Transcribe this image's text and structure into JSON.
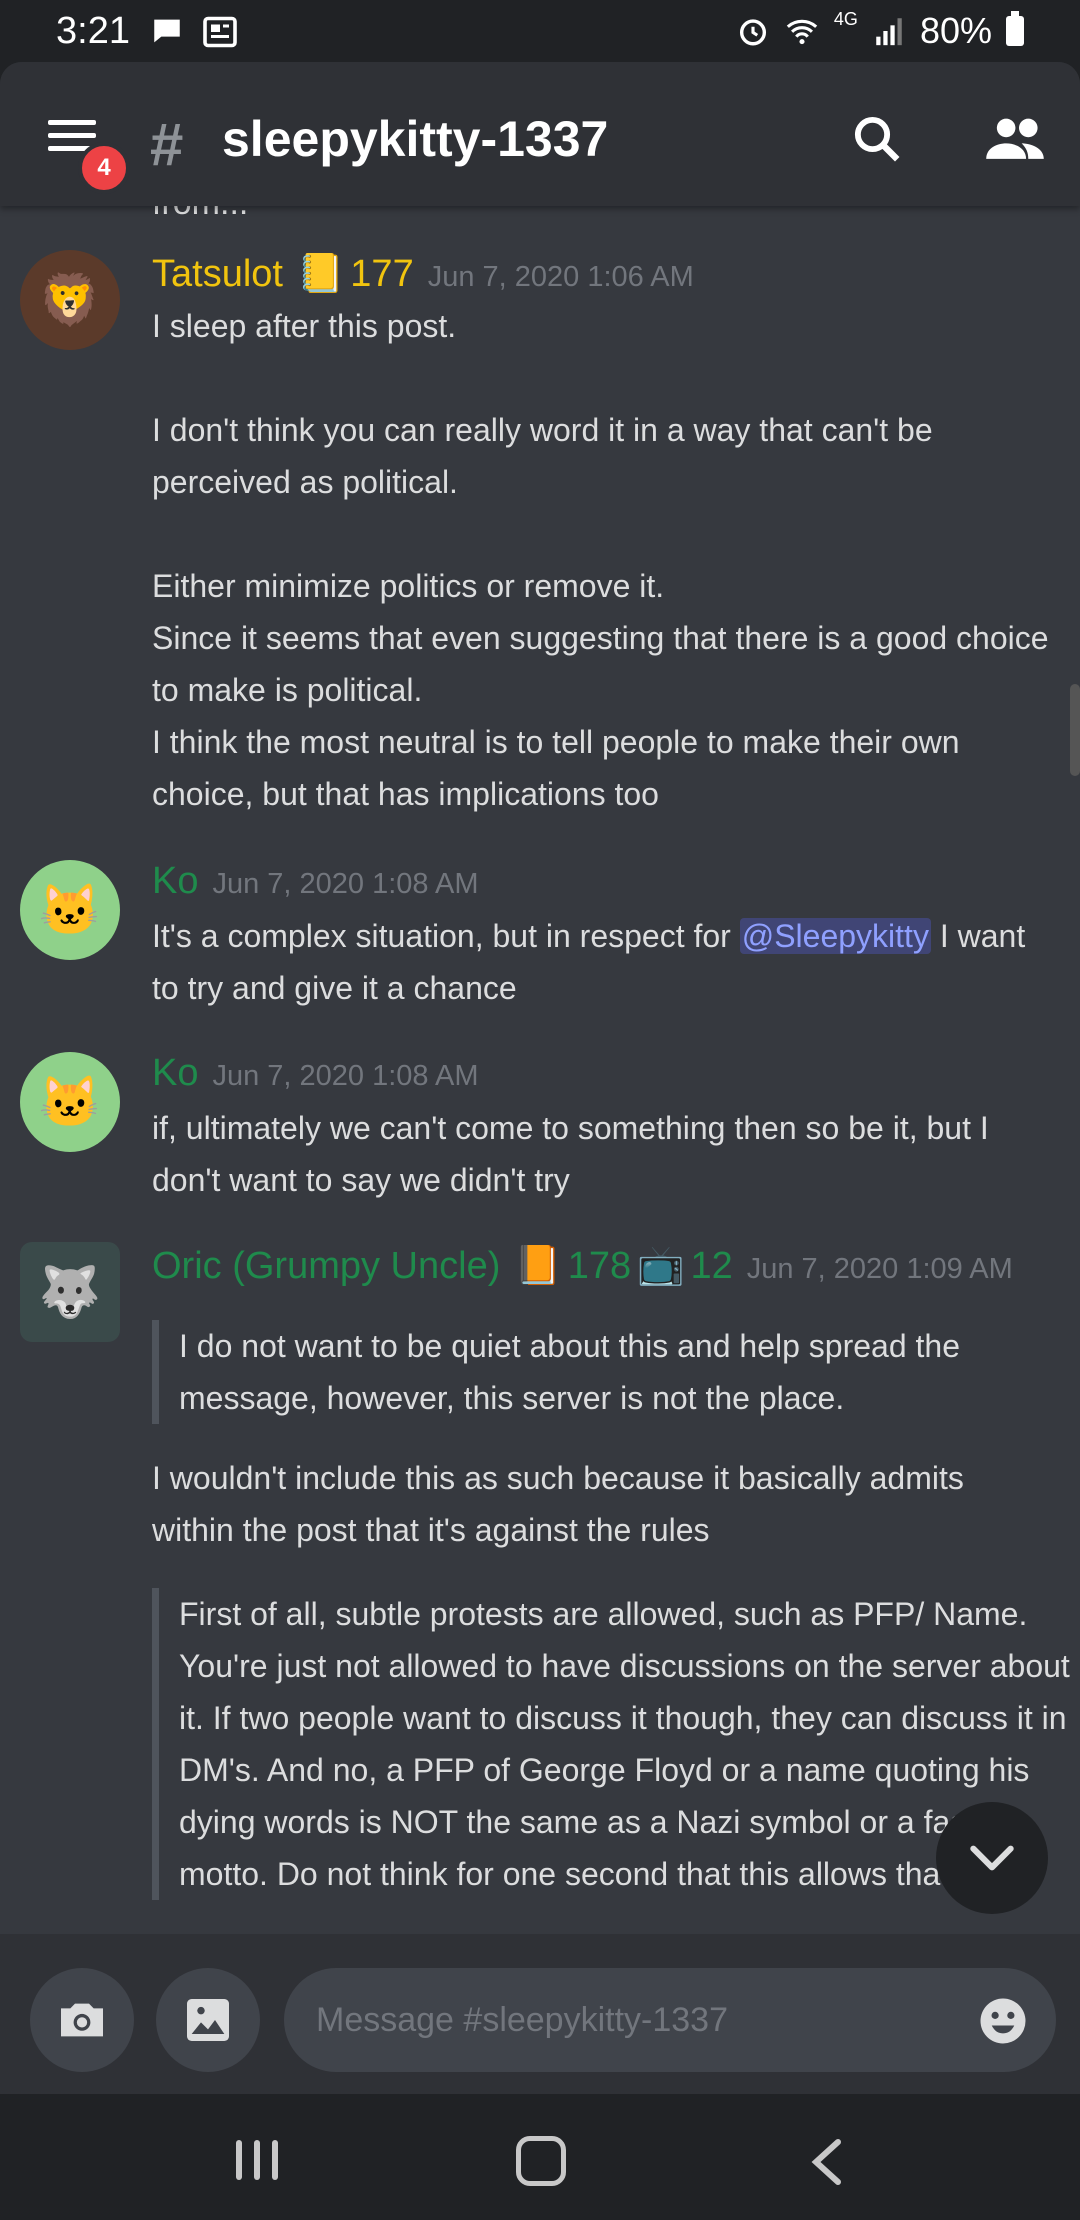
{
  "status_bar": {
    "time": "3:21",
    "network": "4G",
    "battery": "80%"
  },
  "header": {
    "notification_badge": "4",
    "channel_icon": "#",
    "channel_name": "sleepykitty-1337"
  },
  "messages": {
    "cut_top_text": "from...",
    "items": [
      {
        "author": "Tatsulot",
        "badge_emoji": "📒",
        "badge_count": "177",
        "timestamp": "Jun 7, 2020 1:06 AM",
        "lines": [
          "I sleep after this post.",
          "I don't think you can really word it in a way that can't be perceived as political.",
          "Either minimize politics or remove it.",
          "Since it seems that even suggesting that there is a good choice to make is political.",
          "I think the most neutral is to tell people to make their own choice, but that has implications too"
        ]
      },
      {
        "author": "Ko",
        "timestamp": "Jun 7, 2020 1:08 AM",
        "text_before": "It's a complex situation, but in respect for ",
        "mention": "@Sleepykitty",
        "text_after": " I want to try and give it a chance"
      },
      {
        "author": "Ko",
        "timestamp": "Jun 7, 2020 1:08 AM",
        "text": "if, ultimately we can't come to something then so be it, but I don't want to say we didn't try"
      },
      {
        "author": "Oric (Grumpy Uncle)",
        "badge_emoji": "📙",
        "badge_count": "178",
        "badge2_emoji": "📺",
        "badge2_count": "12",
        "timestamp": "Jun 7, 2020 1:09 AM",
        "quote1": "I do not want to be quiet about this and help spread the message, however, this server is not the place.",
        "text": "I wouldn't include this as such because it basically admits within the post that it's against the rules",
        "quote2": "First of all, subtle protests are allowed, such as PFP/ Name.  You're just not allowed to have discussions on the server about it.  If two people want to discuss it though, they can discuss it in DM's.  And no, a PFP of George Floyd or a name quoting his dying words is NOT the same as a Nazi symbol or a fascist motto.  Do not think for one second that this allows that"
      }
    ]
  },
  "composer": {
    "placeholder": "Message #sleepykitty-1337"
  },
  "icons": {
    "hamburger": "menu-icon",
    "search": "search-icon",
    "members": "members-icon",
    "camera": "camera-icon",
    "gallery": "image-icon",
    "emoji": "emoji-icon",
    "jump": "chevron-down-icon"
  },
  "colors": {
    "background": "#36393f",
    "header": "#2f3136",
    "badge": "#ed4245",
    "author_gold": "#f1c40f",
    "author_green": "#2ecc71",
    "mention": "#8fa0ff"
  }
}
